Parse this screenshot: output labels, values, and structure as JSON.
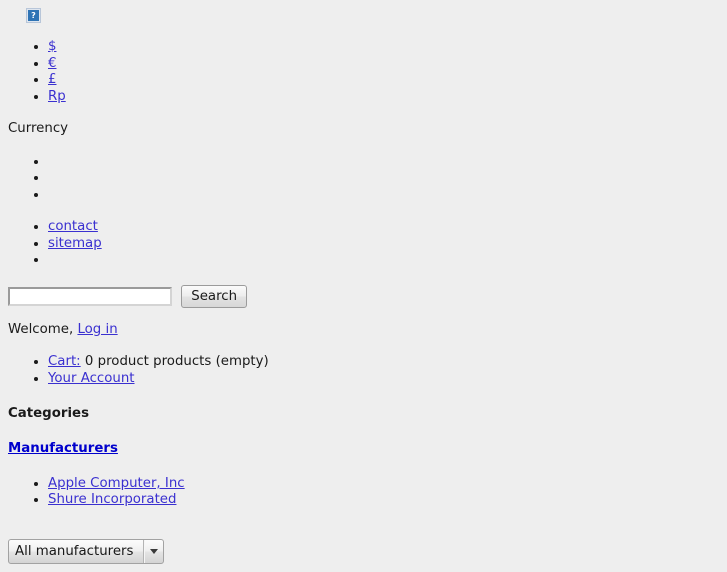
{
  "page": {
    "background_color": "#eeeeee",
    "link_color": "#3a30d0",
    "heading_link_color": "#0000cc",
    "text_color": "#1a1a1a"
  },
  "logo": {
    "alt_placeholder": "broken-image",
    "glyph": "?"
  },
  "currency_block": {
    "items": [
      {
        "label": "$",
        "is_link": true
      },
      {
        "label": "€",
        "is_link": true
      },
      {
        "label": "£",
        "is_link": true
      },
      {
        "label": "Rp",
        "is_link": true
      }
    ],
    "caption": "Currency"
  },
  "blank_nav": {
    "items": [
      "",
      "",
      ""
    ]
  },
  "footer_nav": {
    "items": [
      {
        "label": "contact",
        "is_link": true
      },
      {
        "label": "sitemap",
        "is_link": true
      },
      {
        "label": "",
        "is_link": false
      }
    ]
  },
  "search": {
    "value": "",
    "placeholder": "",
    "button_label": "Search"
  },
  "account_bar": {
    "welcome_text": "Welcome,",
    "login_label": "Log in"
  },
  "cart_block": {
    "cart_label": "Cart:",
    "cart_summary": "0 product products (empty)",
    "account_label": "Your Account"
  },
  "categories_block": {
    "heading": "Categories"
  },
  "manufacturers_block": {
    "heading": "Manufacturers",
    "items": [
      {
        "label": "Apple Computer, Inc"
      },
      {
        "label": "Shure Incorporated"
      }
    ],
    "select": {
      "selected": "All manufacturers",
      "options": [
        "All manufacturers",
        "Apple Computer, Inc",
        "Shure Incorporated"
      ]
    }
  }
}
